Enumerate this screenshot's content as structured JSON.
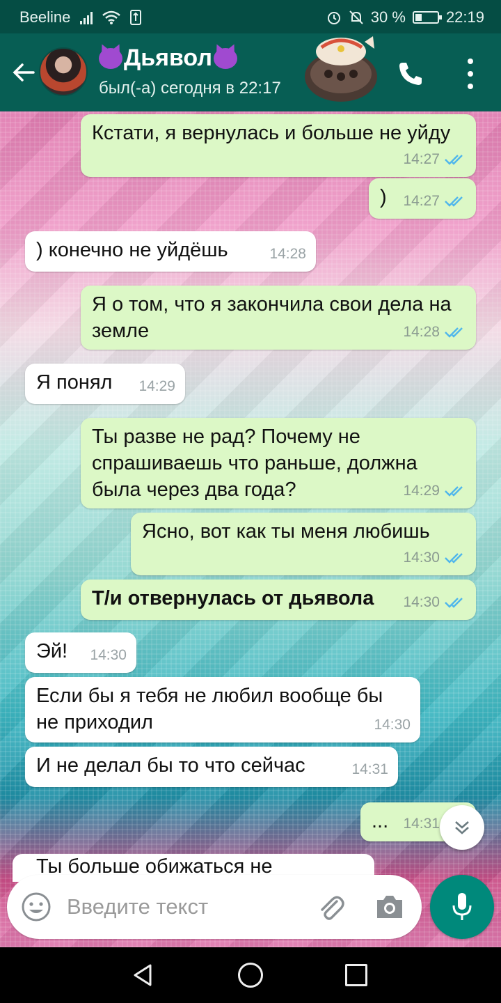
{
  "status_bar": {
    "carrier": "Beeline",
    "battery_percent": "30 %",
    "battery_level": 0.3,
    "time": "22:19"
  },
  "header": {
    "contact_name": "Дьявол",
    "last_seen": "был(-а) сегодня в 22:17",
    "icons": [
      "back-arrow-icon",
      "devil-emoji-icon",
      "call-icon",
      "more-options-icon"
    ]
  },
  "messages": [
    {
      "dir": "out",
      "text": "Кстати, я вернулась и больше не уйду",
      "time": "14:27",
      "read": true
    },
    {
      "dir": "out",
      "text": ")",
      "time": "14:27",
      "read": true
    },
    {
      "dir": "in",
      "text": ") конечно не уйдёшь",
      "time": "14:28"
    },
    {
      "dir": "out",
      "text": "Я о том, что я закончила свои дела на земле",
      "time": "14:28",
      "read": true
    },
    {
      "dir": "in",
      "text": "Я понял",
      "time": "14:29"
    },
    {
      "dir": "out",
      "text": "Ты разве не рад? Почему не спрашиваешь что раньше, должна была через два года?",
      "time": "14:29",
      "read": true
    },
    {
      "dir": "out",
      "text": "Ясно, вот как ты меня любишь",
      "time": "14:30",
      "read": true
    },
    {
      "dir": "out",
      "text": "Т/и отвернулась от дьявола",
      "time": "14:30",
      "read": true,
      "bold": true
    },
    {
      "dir": "in",
      "text": "Эй!",
      "time": "14:30"
    },
    {
      "dir": "in",
      "text": "Если бы я тебя не любил вообще бы не приходил",
      "time": "14:30"
    },
    {
      "dir": "in",
      "text": "И не делал бы то что сейчас",
      "time": "14:31"
    },
    {
      "dir": "out",
      "text": "...",
      "time": "14:31",
      "read": true
    },
    {
      "dir": "in",
      "text": "Ты больше обижаться не будешь?",
      "partial": true
    }
  ],
  "input": {
    "placeholder": "Введите текст"
  },
  "colors": {
    "header": "#075e54",
    "status_bar": "#054d44",
    "outgoing_bubble": "#dcf8c6",
    "incoming_bubble": "#ffffff",
    "read_ticks": "#4fb6ec",
    "mic_button": "#00897b"
  }
}
